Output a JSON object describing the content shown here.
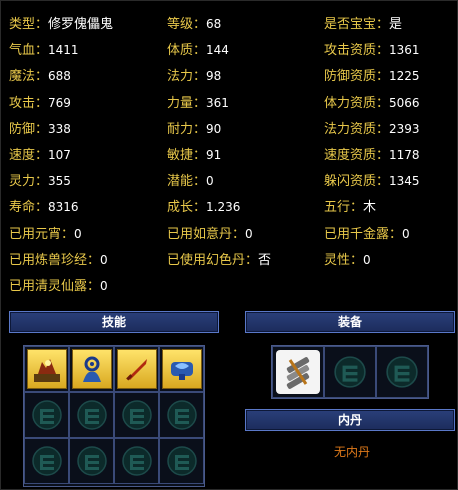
{
  "stats": {
    "rows": [
      [
        {
          "label": "类型：",
          "value": "修罗傀儡鬼"
        },
        {
          "label": "等级：",
          "value": "68"
        },
        {
          "label": "是否宝宝：",
          "value": "是"
        }
      ],
      [
        {
          "label": "气血：",
          "value": "1411"
        },
        {
          "label": "体质：",
          "value": "144"
        },
        {
          "label": "攻击资质：",
          "value": "1361"
        }
      ],
      [
        {
          "label": "魔法：",
          "value": "688"
        },
        {
          "label": "法力：",
          "value": "98"
        },
        {
          "label": "防御资质：",
          "value": "1225"
        }
      ],
      [
        {
          "label": "攻击：",
          "value": "769"
        },
        {
          "label": "力量：",
          "value": "361"
        },
        {
          "label": "体力资质：",
          "value": "5066"
        }
      ],
      [
        {
          "label": "防御：",
          "value": "338"
        },
        {
          "label": "耐力：",
          "value": "90"
        },
        {
          "label": "法力资质：",
          "value": "2393"
        }
      ],
      [
        {
          "label": "速度：",
          "value": "107"
        },
        {
          "label": "敏捷：",
          "value": "91"
        },
        {
          "label": "速度资质：",
          "value": "1178"
        }
      ],
      [
        {
          "label": "灵力：",
          "value": "355"
        },
        {
          "label": "潜能：",
          "value": "0"
        },
        {
          "label": "躲闪资质：",
          "value": "1345"
        }
      ],
      [
        {
          "label": "寿命：",
          "value": "8316"
        },
        {
          "label": "成长：",
          "value": "1.236"
        },
        {
          "label": "五行：",
          "value": "木"
        }
      ],
      [
        {
          "label": "已用元宵：",
          "value": "0"
        },
        {
          "label": "已用如意丹：",
          "value": "0"
        },
        {
          "label": "已用千金露：",
          "value": "0"
        }
      ],
      [
        {
          "label": "已用炼兽珍经：",
          "value": "0"
        },
        {
          "label": "已使用幻色丹：",
          "value": "否"
        },
        {
          "label": "灵性：",
          "value": "0"
        }
      ],
      [
        {
          "label": "已用清灵仙露：",
          "value": "0"
        }
      ]
    ]
  },
  "skills": {
    "title": "技能",
    "filled_icons": [
      "skill-icon-1",
      "skill-icon-2",
      "skill-icon-3",
      "skill-icon-4"
    ],
    "empty_icon": "empty-slot-emblem"
  },
  "equipment": {
    "title": "装备",
    "filled_icons": [
      "equipment-armor-icon"
    ],
    "empty_icon": "empty-slot-emblem"
  },
  "neidan": {
    "title": "内丹",
    "empty_text": "无内丹"
  },
  "colors": {
    "label": "#e8c84a",
    "value": "#ffffff",
    "header_bg": "#23356b",
    "neidan_text": "#e07a1a"
  }
}
